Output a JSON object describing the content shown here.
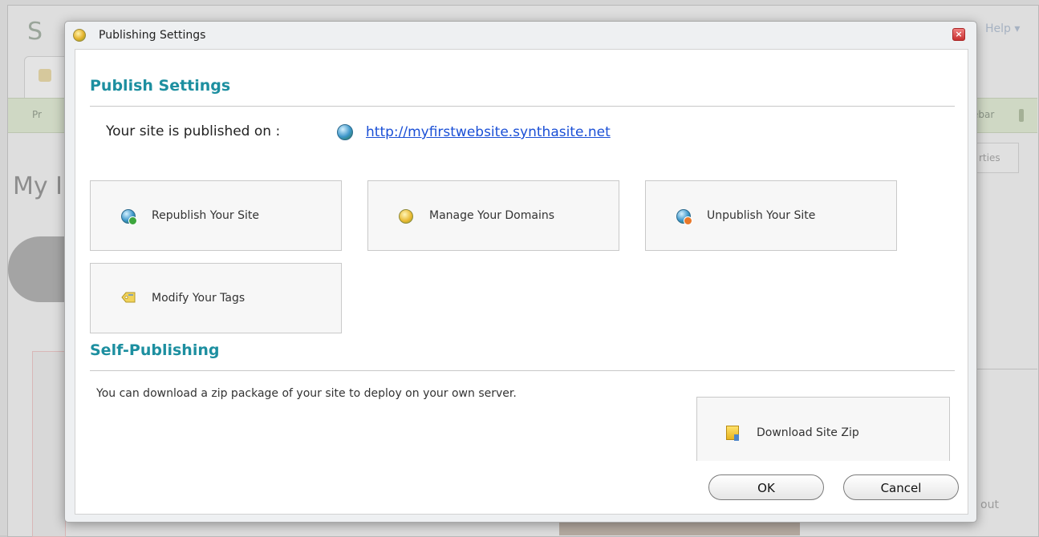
{
  "background": {
    "logo_text": "S",
    "help_label": "Help ▾",
    "toolbar_left_text": "Pr",
    "toolbar_right_text": "ebar",
    "subtab_label": "rties",
    "page_title_fragment": "My I",
    "right_text_fragment": "out"
  },
  "dialog": {
    "title": "Publishing Settings",
    "close_icon": "close-icon",
    "publish_section": {
      "title": "Publish Settings",
      "published_on_label": "Your site is published on :",
      "site_url": "http://myfirstwebsite.synthasite.net",
      "actions": [
        {
          "label": "Republish Your Site",
          "icon": "republish-globe-icon"
        },
        {
          "label": "Manage Your Domains",
          "icon": "pencil-icon"
        },
        {
          "label": "Unpublish Your Site",
          "icon": "unpublish-globe-icon"
        },
        {
          "label": "Modify Your Tags",
          "icon": "tag-icon"
        }
      ]
    },
    "self_publishing_section": {
      "title": "Self-Publishing",
      "description": "You can download a zip package of your site to deploy on your own server.",
      "download_label": "Download Site Zip",
      "download_icon": "zip-icon"
    },
    "footer": {
      "ok_label": "OK",
      "cancel_label": "Cancel"
    }
  },
  "colors": {
    "section_title": "#1d8fa0",
    "link": "#1a4fd6",
    "card_bg": "#f7f7f7"
  }
}
